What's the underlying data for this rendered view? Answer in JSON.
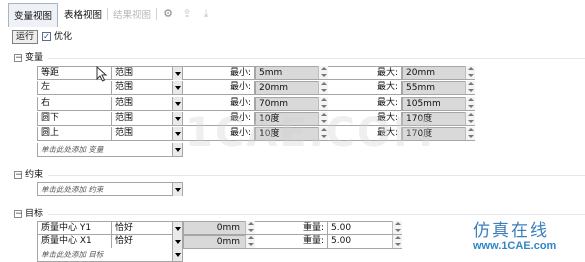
{
  "tabs": [
    {
      "label": "变量视图",
      "state": "active"
    },
    {
      "label": "表格视图",
      "state": "normal"
    },
    {
      "label": "结果视图",
      "state": "disabled"
    }
  ],
  "tab_icons": [
    "gear-icon",
    "export-icon",
    "import-icon"
  ],
  "toolbar": {
    "run_label": "运行",
    "optimize_label": "优化",
    "optimize_checked": true
  },
  "variables": {
    "title": "变量",
    "rows": [
      {
        "name": "等距",
        "type": "范围",
        "min_label": "最小:",
        "min": "5mm",
        "max_label": "最大:",
        "max": "20mm"
      },
      {
        "name": "左",
        "type": "范围",
        "min_label": "最小:",
        "min": "20mm",
        "max_label": "最大:",
        "max": "55mm"
      },
      {
        "name": "右",
        "type": "范围",
        "min_label": "最小:",
        "min": "70mm",
        "max_label": "最大:",
        "max": "105mm"
      },
      {
        "name": "圆下",
        "type": "范围",
        "min_label": "最小:",
        "min": "10度",
        "max_label": "最大:",
        "max": "170度"
      },
      {
        "name": "圆上",
        "type": "范围",
        "min_label": "最小:",
        "min": "10度",
        "max_label": "最大:",
        "max": "170度"
      }
    ],
    "add_label": "单击此处添加 变量"
  },
  "constraints": {
    "title": "约束",
    "add_label": "单击此处添加 约束"
  },
  "goals": {
    "title": "目标",
    "rows": [
      {
        "name": "质量中心 Y1",
        "type": "恰好",
        "value": "0mm",
        "weight_label": "重量:",
        "weight": "5.00"
      },
      {
        "name": "质量中心 X1",
        "type": "恰好",
        "value": "0mm",
        "weight_label": "重量:",
        "weight": "5.00"
      }
    ],
    "add_label": "单击此处添加 目标"
  },
  "watermark": {
    "center": "1CAE.COM",
    "cn": "仿真在线",
    "url": "www.1CAE.com"
  }
}
